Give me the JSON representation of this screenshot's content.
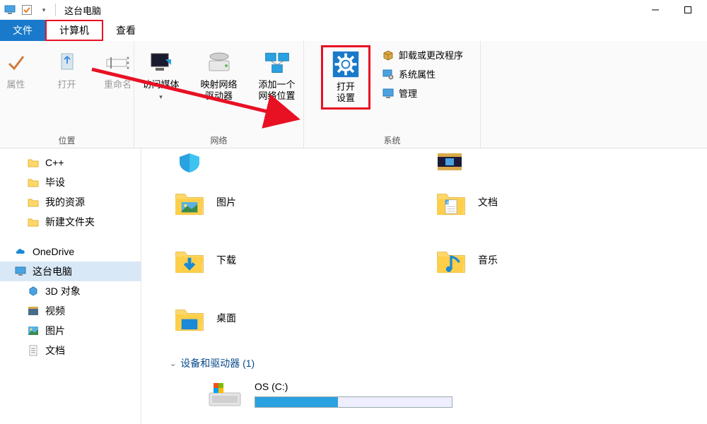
{
  "window": {
    "title": "这台电脑"
  },
  "tabs": {
    "file": "文件",
    "computer": "计算机",
    "view": "查看"
  },
  "ribbon": {
    "location": {
      "label": "位置",
      "properties": "属性",
      "open": "打开",
      "rename": "重命名"
    },
    "network": {
      "label": "网络",
      "media": "访问媒体",
      "map_drive": "映射网络\n驱动器",
      "add_location": "添加一个\n网络位置"
    },
    "system": {
      "label": "系统",
      "open_settings": "打开\n设置",
      "uninstall": "卸载或更改程序",
      "sys_props": "系统属性",
      "manage": "管理"
    }
  },
  "sidebar": {
    "items": [
      {
        "label": "C++",
        "indent": 2,
        "icon": "folder"
      },
      {
        "label": "毕设",
        "indent": 2,
        "icon": "folder"
      },
      {
        "label": "我的资源",
        "indent": 2,
        "icon": "folder"
      },
      {
        "label": "新建文件夹",
        "indent": 2,
        "icon": "folder"
      },
      {
        "label": "OneDrive",
        "indent": 1,
        "icon": "onedrive"
      },
      {
        "label": "这台电脑",
        "indent": 1,
        "icon": "pc",
        "selected": true
      },
      {
        "label": "3D 对象",
        "indent": 2,
        "icon": "3d"
      },
      {
        "label": "视频",
        "indent": 2,
        "icon": "video"
      },
      {
        "label": "图片",
        "indent": 2,
        "icon": "pictures"
      },
      {
        "label": "文档",
        "indent": 2,
        "icon": "docs"
      }
    ]
  },
  "main": {
    "folders": {
      "left": [
        {
          "name": "图片",
          "icon": "pictures"
        },
        {
          "name": "下载",
          "icon": "downloads"
        },
        {
          "name": "桌面",
          "icon": "desktop"
        }
      ],
      "right": [
        {
          "name": "文档",
          "icon": "docs-large"
        },
        {
          "name": "音乐",
          "icon": "music"
        }
      ]
    },
    "section": {
      "title": "设备和驱动器 (1)"
    },
    "drive": {
      "name": "OS (C:)",
      "fill_pct": 42
    }
  }
}
